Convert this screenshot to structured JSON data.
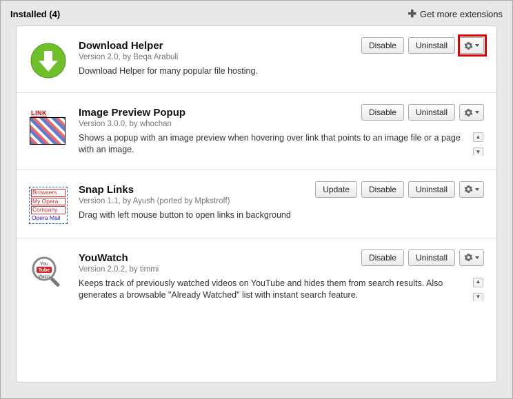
{
  "header": {
    "title": "Installed (4)",
    "get_more": "Get more extensions"
  },
  "buttons": {
    "disable": "Disable",
    "uninstall": "Uninstall",
    "update": "Update"
  },
  "extensions": [
    {
      "name": "Download Helper",
      "meta": "Version 2.0,  by Beqa Arabuli",
      "desc": "Download Helper for many popular file hosting."
    },
    {
      "name": "Image Preview Popup",
      "meta": "Version 3.0.0,  by whochan",
      "desc": "Shows a popup with an image preview when hovering over link that points to an image file or a page with an image."
    },
    {
      "name": "Snap Links",
      "meta": "Version 1.1,  by Ayush (ported by Mpkstroff)",
      "desc": "Drag with left mouse button to open links in background"
    },
    {
      "name": "YouWatch",
      "meta": "Version 2.0.2,  by timmi",
      "desc": "Keeps track of previously watched videos on YouTube and hides them from search results. Also generates a browsable \"Already Watched\" list with instant search feature."
    }
  ],
  "icons": {
    "image_preview_link": "LINK",
    "snap_rows": {
      "r1": "Browsers",
      "r2": "My Opera",
      "r3": "Company",
      "r4": "Opera Mail"
    },
    "youwatch": {
      "you": "You",
      "tube": "Tube",
      "watch": "Watch"
    }
  }
}
